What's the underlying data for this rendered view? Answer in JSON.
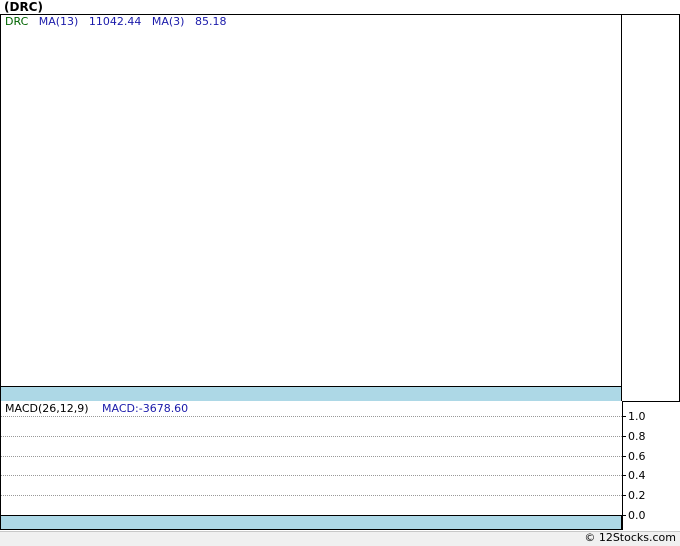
{
  "header": {
    "title": "(DRC)"
  },
  "price_legend": {
    "symbol": "DRC",
    "ma13_label": "MA(13)",
    "ma13_value": "11042.44",
    "ma3_label": "MA(3)",
    "ma3_value": "85.18"
  },
  "macd_legend": {
    "label": "MACD(26,12,9)",
    "value": "MACD:-3678.60"
  },
  "chart_data": {
    "type": "line",
    "title": "(DRC)",
    "series": [],
    "macd_axis": {
      "ylim": [
        0.0,
        1.0
      ],
      "ticks": [
        "1.0",
        "0.8",
        "0.6",
        "0.4",
        "0.2",
        "0.0"
      ]
    },
    "grid": true
  },
  "footer": {
    "credit": "© 12Stocks.com"
  }
}
